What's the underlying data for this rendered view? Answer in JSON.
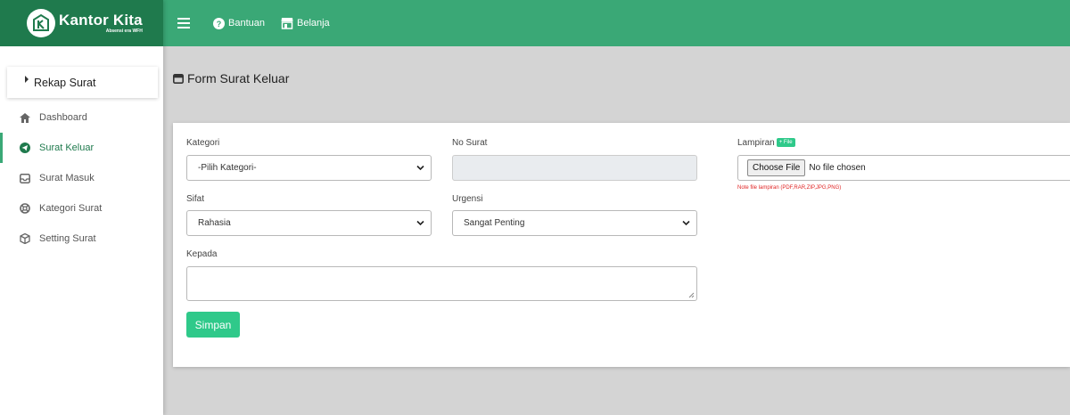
{
  "brand": {
    "title": "Kantor Kita",
    "subtitle": "Absensi era WFH"
  },
  "topbar": {
    "links": [
      {
        "label": "Bantuan",
        "icon": "question-circle-icon"
      },
      {
        "label": "Belanja",
        "icon": "store-icon"
      }
    ]
  },
  "sidebar": {
    "section": "Rekap Surat",
    "items": [
      {
        "label": "Dashboard",
        "icon": "home-icon",
        "active": false
      },
      {
        "label": "Surat Keluar",
        "icon": "send-icon",
        "active": true
      },
      {
        "label": "Surat Masuk",
        "icon": "inbox-icon",
        "active": false
      },
      {
        "label": "Kategori Surat",
        "icon": "lifebuoy-icon",
        "active": false
      },
      {
        "label": "Setting Surat",
        "icon": "cube-icon",
        "active": false
      }
    ]
  },
  "page": {
    "title": "Form Surat Keluar"
  },
  "form": {
    "kategori": {
      "label": "Kategori",
      "value": "-Pilih Kategori-"
    },
    "no_surat": {
      "label": "No Surat",
      "value": ""
    },
    "sifat": {
      "label": "Sifat",
      "value": "Rahasia"
    },
    "urgensi": {
      "label": "Urgensi",
      "value": "Sangat Penting"
    },
    "kepada": {
      "label": "Kepada",
      "value": ""
    },
    "lampiran": {
      "label": "Lampiran",
      "badge": "+ File",
      "button": "Choose File",
      "status": "No file chosen",
      "note": "Note file lampiran (PDF,RAR,ZIP,JPG,PNG)"
    },
    "submit": "Simpan"
  },
  "colors": {
    "brand_dark": "#1f7a4d",
    "brand": "#3aa876",
    "accent": "#2fc98a",
    "error": "#e02424"
  }
}
